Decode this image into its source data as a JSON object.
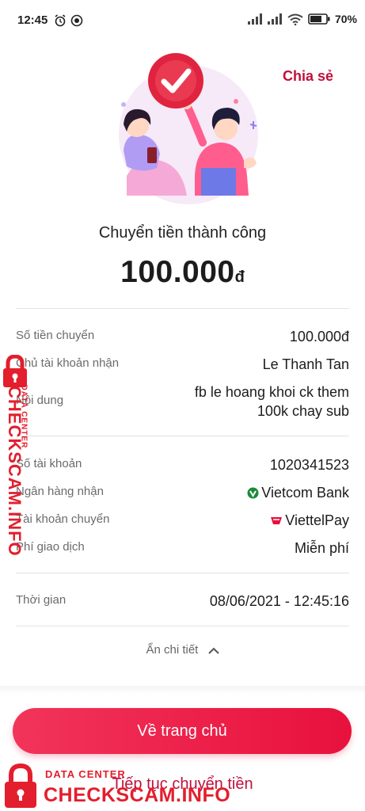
{
  "status_bar": {
    "time": "12:45",
    "battery": "70%",
    "icons": [
      "alarm-icon",
      "data-saver-icon",
      "signal-icon",
      "signal-icon",
      "wifi-icon",
      "battery-icon"
    ]
  },
  "header": {
    "share_label": "Chia sẻ"
  },
  "result": {
    "title": "Chuyển tiền thành công",
    "amount": "100.000",
    "currency": "đ"
  },
  "details": {
    "amount": {
      "label": "Số tiền chuyển",
      "value": "100.000đ"
    },
    "recipient_name": {
      "label": "Chủ tài khoản nhận",
      "value": "Le Thanh Tan"
    },
    "content": {
      "label": "Nội dung",
      "value_line1": "fb le hoang khoi ck them",
      "value_line2": "100k chay sub"
    },
    "account_number": {
      "label": "Số tài khoản",
      "value": "1020341523"
    },
    "bank": {
      "label": "Ngân hàng nhận",
      "value": "Vietcom Bank"
    },
    "source_account": {
      "label": "Tài khoản chuyển",
      "value": "ViettelPay"
    },
    "fee": {
      "label": "Phí giao dịch",
      "value": "Miễn phí"
    },
    "time": {
      "label": "Thời gian",
      "value": "08/06/2021 - 12:45:16"
    },
    "toggle_label": "Ẩn chi tiết"
  },
  "actions": {
    "home_label": "Về trang chủ",
    "continue_label": "Tiếp tục chuyển tiền"
  },
  "watermark": {
    "line1": "DATA CENTER",
    "line2": "CHECKSCAM.INFO"
  },
  "colors": {
    "brand": "#e8113d",
    "brand_text": "#c0103c",
    "watermark": "#e31e2d"
  }
}
